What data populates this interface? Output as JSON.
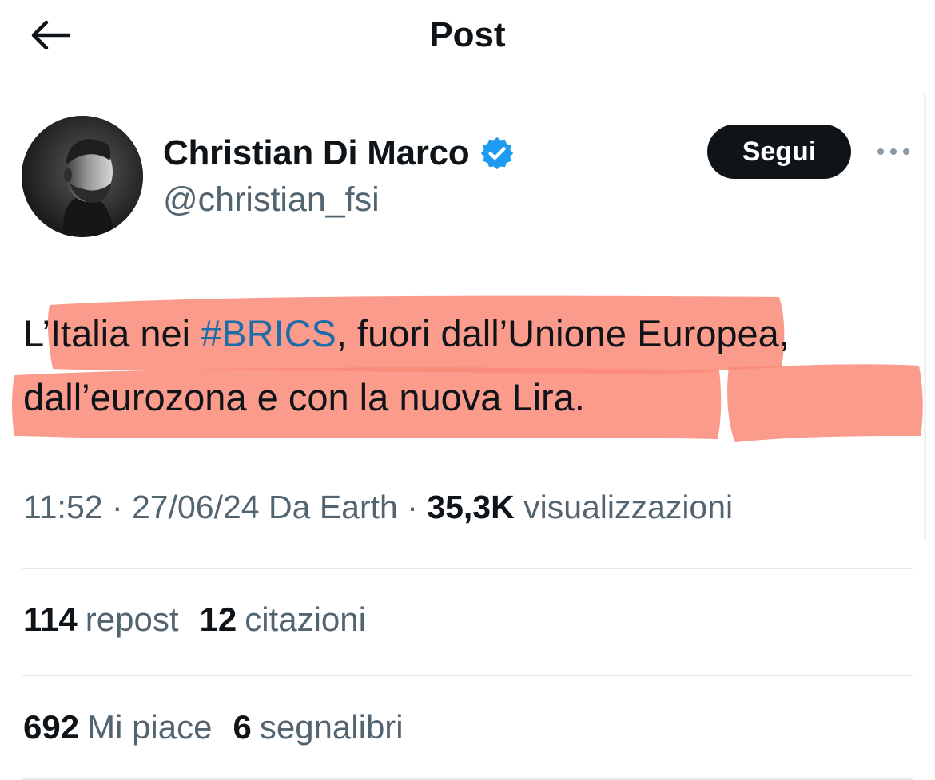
{
  "header": {
    "title": "Post",
    "back_icon": "arrow-left-icon"
  },
  "author": {
    "display_name": "Christian Di Marco",
    "handle": "@christian_fsi",
    "verified_icon": "verified-badge-icon",
    "verified_color": "#1d9bf0"
  },
  "actions": {
    "follow_label": "Segui",
    "more_icon": "more-horizontal-icon"
  },
  "post": {
    "text_part1": "L’Italia nei ",
    "hashtag": "#BRICS",
    "text_part2": ", fuori dall’Unione Europea, dall’eurozona e con la nuova Lira.",
    "highlight_color": "#fa8a78"
  },
  "meta": {
    "time": "11:52",
    "separator": " · ",
    "date": "27/06/24",
    "source": "Da Earth",
    "views_count": "35,3K",
    "views_label": "visualizzazioni"
  },
  "stats": {
    "reposts_count": "114",
    "reposts_label": "repost",
    "quotes_count": "12",
    "quotes_label": "citazioni",
    "likes_count": "692",
    "likes_label": "Mi piace",
    "bookmarks_count": "6",
    "bookmarks_label": "segnalibri"
  },
  "colors": {
    "text_primary": "#0f1419",
    "text_secondary": "#536471",
    "hashtag": "#1d6ea8",
    "button_bg": "#0f1419"
  }
}
